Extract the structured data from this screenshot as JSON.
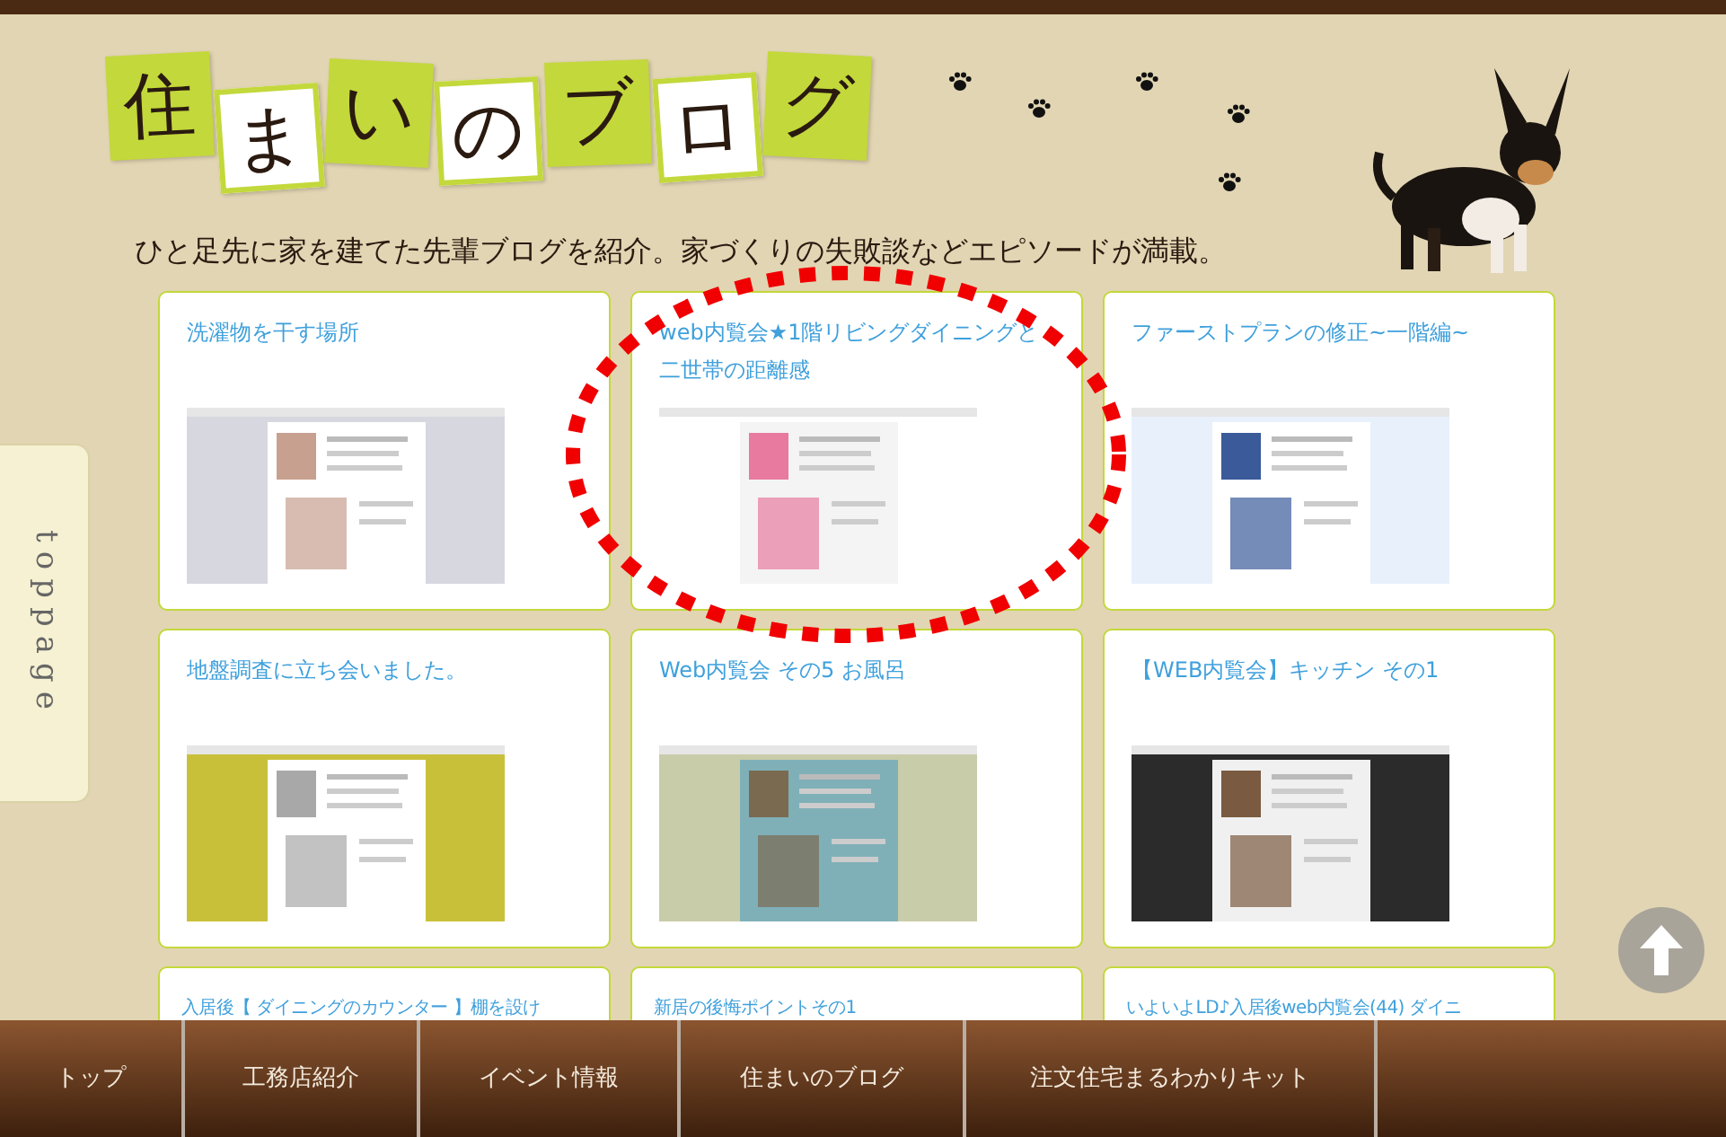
{
  "header": {
    "title_tiles": [
      {
        "char": "住",
        "color": "#c3d83a"
      },
      {
        "char": "ま",
        "color": "#ffffff"
      },
      {
        "char": "い",
        "color": "#c3d83a"
      },
      {
        "char": "の",
        "color": "#ffffff"
      },
      {
        "char": "ブ",
        "color": "#c3d83a"
      },
      {
        "char": "ロ",
        "color": "#ffffff"
      },
      {
        "char": "グ",
        "color": "#c3d83a"
      }
    ],
    "tagline": "ひと足先に家を建てた先輩ブログを紹介。家づくりの失敗談などエピソードが満載。"
  },
  "side_tab": {
    "label": "toppage"
  },
  "posts": [
    {
      "title": "洗濯物を干す場所"
    },
    {
      "title": "web内覧会★1階リビングダイニングと二世帯の距離感"
    },
    {
      "title": "ファーストプランの修正~一階編~"
    },
    {
      "title": "地盤調査に立ち会いました。"
    },
    {
      "title": "Web内覧会 その5 お風呂"
    },
    {
      "title": "【WEB内覧会】キッチン その1"
    },
    {
      "title": "入居後【 ダイニングのカウンター 】棚を設け"
    },
    {
      "title": "新居の後悔ポイントその1"
    },
    {
      "title": "いよいよLD♪入居後web内覧会(44) ダイニ"
    }
  ],
  "footer_nav": [
    {
      "label": "トップ"
    },
    {
      "label": "工務店紹介"
    },
    {
      "label": "イベント情報"
    },
    {
      "label": "住まいのブログ"
    },
    {
      "label": "注文住宅まるわかりキット"
    }
  ]
}
